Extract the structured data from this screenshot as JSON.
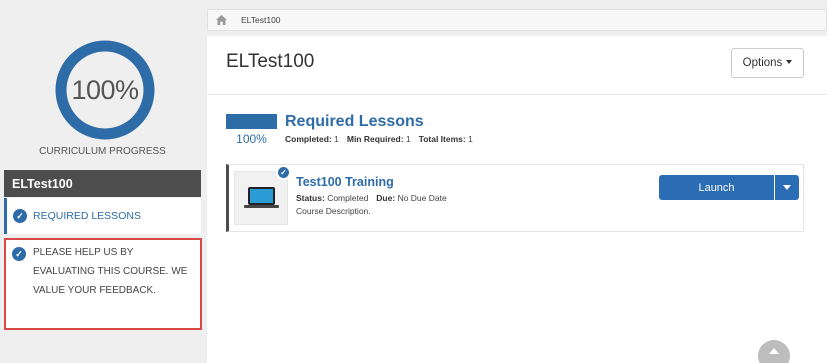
{
  "sidebar": {
    "progress_value": "100%",
    "progress_fraction": 1.0,
    "progress_label": "CURRICULUM PROGRESS",
    "course_title": "ELTest100",
    "nav_items": [
      {
        "label": "REQUIRED LESSONS",
        "icon": "check-circle-icon"
      },
      {
        "label": "PLEASE HELP US BY EVALUATING THIS COURSE. WE VALUE YOUR FEEDBACK.",
        "icon": "check-circle-icon"
      }
    ]
  },
  "breadcrumb": {
    "home_icon": "home-icon",
    "current": "ELTest100"
  },
  "main": {
    "title": "ELTest100",
    "options_label": "Options",
    "section": {
      "progress_pct": "100%",
      "progress_fraction": 1.0,
      "title": "Required Lessons",
      "completed_label": "Completed:",
      "completed_value": "1",
      "min_required_label": "Min Required:",
      "min_required_value": "1",
      "total_items_label": "Total Items:",
      "total_items_value": "1"
    },
    "lesson": {
      "title": "Test100 Training",
      "status_label": "Status:",
      "status_value": "Completed",
      "due_label": "Due:",
      "due_value": "No Due Date",
      "description": "Course Description.",
      "launch_label": "Launch",
      "thumb_icon": "laptop-icon"
    }
  },
  "colors": {
    "accent": "#2e6ca8",
    "highlight_border": "#d94848",
    "header_dark": "#4d4d4d"
  }
}
